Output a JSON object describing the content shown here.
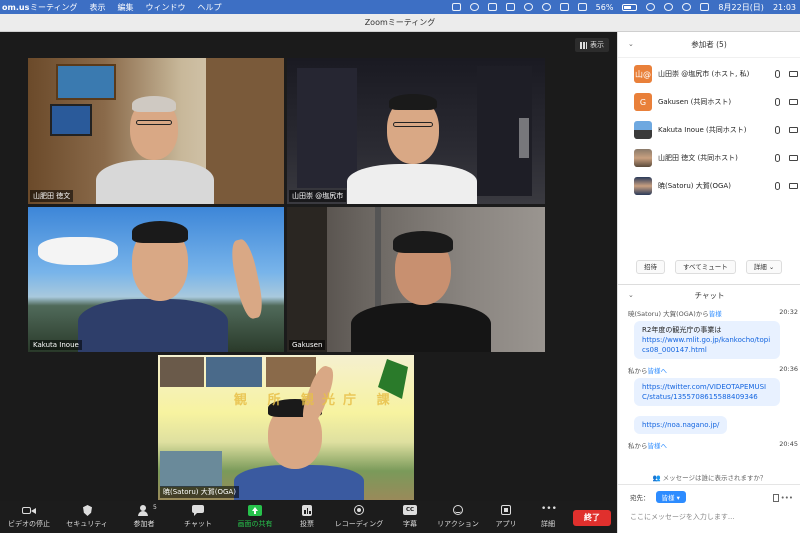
{
  "menubar": {
    "app": "om.us",
    "menus": [
      "ミーティング",
      "表示",
      "編集",
      "ウィンドウ",
      "ヘルプ"
    ],
    "battery": "56%",
    "date": "8月22日(日)",
    "time": "21:03"
  },
  "window": {
    "title": "Zoomミーティング"
  },
  "video": {
    "view_label": "表示",
    "tiles": [
      {
        "name": "山肥田 徳文"
      },
      {
        "name": "山田崇 @塩尻市"
      },
      {
        "name": "Kakuta Inoue"
      },
      {
        "name": "Gakusen"
      },
      {
        "name": "暁(Satoru) 大賀(OGA)"
      }
    ],
    "banner_text": "観 所 観光庁 課"
  },
  "toolbar": {
    "items": [
      {
        "label": "ビデオの停止",
        "icon": "video-camera-icon"
      },
      {
        "label": "セキュリティ",
        "icon": "shield-icon"
      },
      {
        "label": "参加者",
        "icon": "participants-icon",
        "count": "5"
      },
      {
        "label": "チャット",
        "icon": "chat-icon"
      },
      {
        "label": "画面の共有",
        "icon": "share-screen-icon"
      },
      {
        "label": "投票",
        "icon": "poll-icon"
      },
      {
        "label": "レコーディング",
        "icon": "record-icon"
      },
      {
        "label": "字幕",
        "icon": "cc-icon",
        "badge": "CC"
      },
      {
        "label": "リアクション",
        "icon": "reaction-icon"
      },
      {
        "label": "アプリ",
        "icon": "apps-icon"
      },
      {
        "label": "詳細",
        "icon": "more-icon"
      }
    ],
    "end_label": "終了",
    "accent": "#27c24c",
    "end_color": "#e0302d"
  },
  "participants": {
    "title": "参加者 (5)",
    "list": [
      {
        "name": "山田崇 @塩尻市 (ホスト, 私)",
        "avatar": "山@",
        "color": "#e9803a"
      },
      {
        "name": "Gakusen (共同ホスト)",
        "avatar": "G",
        "color": "#e9803a"
      },
      {
        "name": "Kakuta Inoue (共同ホスト)",
        "avatar": "",
        "color": "#4a6a8a"
      },
      {
        "name": "山肥田 徳文 (共同ホスト)",
        "avatar": "",
        "color": "#6a5a4a"
      },
      {
        "name": "暁(Satoru) 大賀(OGA)",
        "avatar": "",
        "color": "#3a4a6a"
      }
    ],
    "actions": [
      "招待",
      "すべてミュート",
      "詳細"
    ]
  },
  "chat": {
    "title": "チャット",
    "messages": [
      {
        "from": "暁(Satoru) 大賀(OGA)から",
        "to": "皆様",
        "time": "20:32",
        "text": "R2年度の観光庁の事業は",
        "link": "https://www.mlit.go.jp/kankocho/topics08_000147.html"
      },
      {
        "from": "私から",
        "to": "皆様へ",
        "time": "20:36",
        "text": "",
        "link": "https://twitter.com/VIDEOTAPEMUSIC/status/1355708615588409346"
      },
      {
        "from": "",
        "to": "",
        "time": "",
        "text": "",
        "link": "https://noa.nagano.jp/"
      },
      {
        "from": "私から",
        "to": "皆様へ",
        "time": "20:45",
        "text": "",
        "link": ""
      }
    ],
    "hint": "メッセージは誰に表示されますか？",
    "to_label": "宛先：",
    "to_value": "皆様",
    "placeholder": "ここにメッセージを入力します..."
  }
}
